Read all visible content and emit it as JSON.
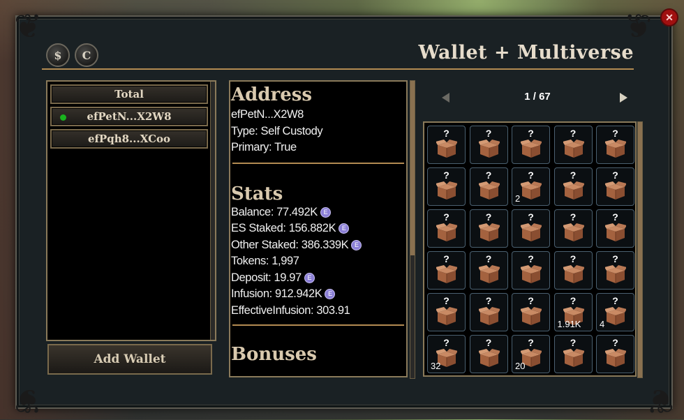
{
  "window": {
    "title": "Wallet + Multiverse",
    "buttons": [
      {
        "label": "$"
      },
      {
        "label": "C"
      }
    ],
    "close_label": "✕"
  },
  "wallets": {
    "items": [
      {
        "label": "Total",
        "active": false
      },
      {
        "label": "efPetN...X2W8",
        "active": true
      },
      {
        "label": "efPqh8...XCoo",
        "active": false
      }
    ],
    "add_label": "Add Wallet"
  },
  "details": {
    "address_heading": "Address",
    "address": "efPetN...X2W8",
    "type": "Type: Self Custody",
    "primary": "Primary: True",
    "stats_heading": "Stats",
    "stats": [
      {
        "text": "Balance: 77.492K",
        "coin": true
      },
      {
        "text": "ES Staked: 156.882K",
        "coin": true
      },
      {
        "text": "Other Staked: 386.339K",
        "coin": true
      },
      {
        "text": "Tokens: 1,997",
        "coin": false
      },
      {
        "text": "Deposit: 19.97",
        "coin": true
      },
      {
        "text": "Infusion: 912.942K",
        "coin": true
      },
      {
        "text": "EffectiveInfusion: 303.91",
        "coin": false
      }
    ],
    "bonuses_heading": "Bonuses",
    "coin_glyph": "E"
  },
  "pager": {
    "text": "1 / 67"
  },
  "items": [
    {
      "count": ""
    },
    {
      "count": ""
    },
    {
      "count": ""
    },
    {
      "count": ""
    },
    {
      "count": ""
    },
    {
      "count": ""
    },
    {
      "count": ""
    },
    {
      "count": "2"
    },
    {
      "count": ""
    },
    {
      "count": ""
    },
    {
      "count": ""
    },
    {
      "count": ""
    },
    {
      "count": ""
    },
    {
      "count": ""
    },
    {
      "count": ""
    },
    {
      "count": ""
    },
    {
      "count": ""
    },
    {
      "count": ""
    },
    {
      "count": ""
    },
    {
      "count": ""
    },
    {
      "count": ""
    },
    {
      "count": ""
    },
    {
      "count": ""
    },
    {
      "count": "1.91K"
    },
    {
      "count": "4"
    },
    {
      "count": "32"
    },
    {
      "count": ""
    },
    {
      "count": "20"
    },
    {
      "count": ""
    },
    {
      "count": ""
    }
  ],
  "item_question": "?",
  "colors": {
    "accent": "#b38b52",
    "panel": "#1a2124",
    "coin": "#8b7fd6",
    "active_dot": "#19b31e"
  }
}
